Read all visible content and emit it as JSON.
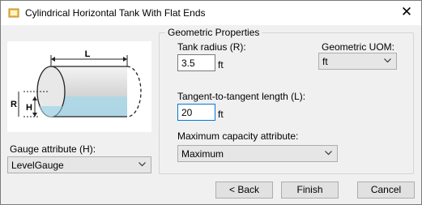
{
  "window": {
    "title": "Cylindrical Horizontal Tank With Flat Ends",
    "close_symbol": "✕"
  },
  "diagram": {
    "label_length": "L",
    "label_radius": "R",
    "label_height": "H"
  },
  "gauge": {
    "label": "Gauge attribute (H):",
    "value": "LevelGauge"
  },
  "geometry": {
    "group_title": "Geometric Properties",
    "tank_radius_label": "Tank radius (R):",
    "tank_radius_value": "3.5",
    "tank_radius_unit": "ft",
    "uom_label": "Geometric UOM:",
    "uom_value": "ft",
    "length_label": "Tangent-to-tangent length (L):",
    "length_value": "20",
    "length_unit": "ft",
    "capacity_label": "Maximum capacity attribute:",
    "capacity_value": "Maximum"
  },
  "buttons": {
    "back": "< Back",
    "finish": "Finish",
    "cancel": "Cancel"
  },
  "colors": {
    "focus": "#0078d7",
    "liquid": "#a9d8ea"
  }
}
